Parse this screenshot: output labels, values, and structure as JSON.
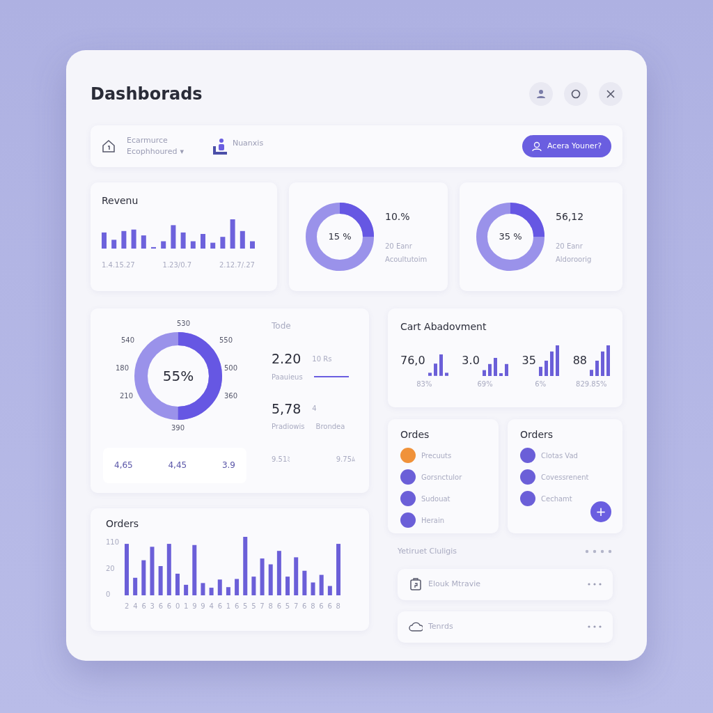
{
  "window": {
    "title": "Dashborads"
  },
  "header_buttons": [
    {
      "kind": "user"
    },
    {
      "kind": "circle"
    },
    {
      "kind": "close"
    }
  ],
  "toolbar": {
    "store": {
      "line1": "Ecarmurce",
      "line2": "Ecophhoured",
      "caret": "▾"
    },
    "user_label": "Nuanxis",
    "action_button": "Acera Youner?"
  },
  "revenue": {
    "title": "Revenu",
    "labels": [
      "1.4.15.27",
      "1.23/0.7",
      "2.12.7/.27"
    ]
  },
  "rings": [
    {
      "center": "15 %",
      "value": "10.%",
      "sub": "20 Eanr",
      "caption": "Acoultutoim"
    },
    {
      "center": "35 %",
      "value": "56,12",
      "sub": "20 Eanr",
      "caption": "Aldoroorig"
    }
  ],
  "overview": {
    "center": "55%",
    "ring_labels": [
      "530",
      "550",
      "500",
      "360",
      "390",
      "210",
      "180",
      "540"
    ],
    "stats_title": "Tode",
    "stats": [
      {
        "kind": "underlined",
        "value": "2.20",
        "aside": "10 Rs",
        "caption": "Paauieus"
      },
      {
        "kind": "plain",
        "value": "5,78",
        "aside": "4",
        "caption": "Pradiowis",
        "extra": "Brondea"
      }
    ],
    "footer_values": [
      "9.51ﾐ",
      "9.75ﾑ"
    ],
    "strip": [
      "4,65",
      "4,45",
      "3.9"
    ]
  },
  "cart": {
    "title": "Cart Abadovment",
    "groups": [
      {
        "value": "76,0",
        "percent": "83%"
      },
      {
        "value": "3.0",
        "percent": "69%"
      },
      {
        "value": "35",
        "percent": "6%"
      },
      {
        "value": "88",
        "percent": "829.85%"
      }
    ]
  },
  "order_lists": [
    {
      "title": "Ordes",
      "items": [
        {
          "label": "Precuuts",
          "color": "#f0923a"
        },
        {
          "label": "Gorsnctulor",
          "color": "#6b5fd8"
        },
        {
          "label": "Sudouat",
          "color": "#6b5fd8"
        },
        {
          "label": "Herain",
          "color": "#6b5fd8"
        }
      ]
    },
    {
      "title": "Orders",
      "items": [
        {
          "label": "Clotas Vad",
          "color": "#6b5fd8"
        },
        {
          "label": "Covessrenent",
          "color": "#6b5fd8"
        },
        {
          "label": "Cechamt",
          "color": "#6b5fd8"
        }
      ],
      "add_button": "+"
    }
  ],
  "orders_chart": {
    "title": "Orders",
    "yticks": [
      "110",
      "20",
      "0"
    ],
    "xlabels": [
      "2",
      "4",
      "6",
      "3",
      "6",
      "6",
      "0",
      "1",
      "9",
      "9",
      "4",
      "6",
      "1",
      "6",
      "5",
      "5",
      "7",
      "8",
      "6",
      "5",
      "7",
      "6",
      "8",
      "6",
      "6",
      "8"
    ]
  },
  "section": {
    "title": "Yetiruet Cluligis",
    "items": [
      {
        "kind": "tag",
        "label": "Elouk Mtravie"
      },
      {
        "kind": "cloud",
        "label": "Tenrds"
      }
    ]
  }
}
